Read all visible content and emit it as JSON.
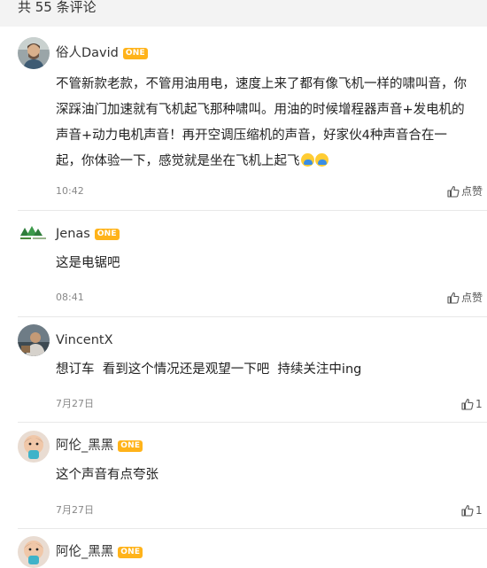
{
  "header": {
    "title": "共 55 条评论"
  },
  "badge_label": "ONE",
  "comments": [
    {
      "username": "俗人David",
      "content": "不管新款老款，不管用油用电，速度上来了都有像飞机一样的啸叫音，你深踩油门加速就有飞机起飞那种啸叫。用油的时候增程器声音+发电机的声音+动力电机声音！再开空调压缩机的声音，好家伙4种声音合在一起，你体验一下，感觉就是坐在飞机上起飞",
      "time": "10:42",
      "like_label": "点赞"
    },
    {
      "username": "Jenas",
      "content": "这是电锯吧",
      "time": "08:41",
      "like_label": "点赞"
    },
    {
      "username": "VincentX",
      "content": "想订车  看到这个情况还是观望一下吧  持续关注中ing",
      "time": "7月27日",
      "like_label": "1"
    },
    {
      "username": "阿伦_黑黑",
      "content": "这个声音有点夸张",
      "time": "7月27日",
      "like_label": "1"
    },
    {
      "username": "阿伦_黑黑"
    }
  ],
  "icons": {
    "like": "thumbs-up-icon",
    "emoji": "crying-laughing-emoji-icon"
  },
  "colors": {
    "badge": "#ffb31a",
    "header_bg": "#f3f3f3",
    "time_text": "#888888"
  }
}
